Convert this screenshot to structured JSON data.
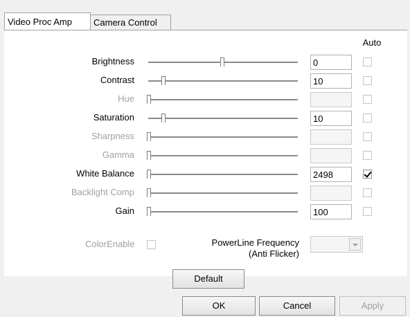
{
  "tabs": [
    {
      "label": "Video Proc Amp",
      "active": true
    },
    {
      "label": "Camera Control",
      "active": false
    }
  ],
  "auto_header": "Auto",
  "controls": [
    {
      "label": "Brightness",
      "value": "0",
      "slider_fraction": 0.5,
      "enabled": true,
      "auto": false,
      "auto_enabled": false
    },
    {
      "label": "Contrast",
      "value": "10",
      "slider_fraction": 0.1,
      "enabled": true,
      "auto": false,
      "auto_enabled": false
    },
    {
      "label": "Hue",
      "value": "",
      "slider_fraction": 0.0,
      "enabled": false,
      "auto": false,
      "auto_enabled": false
    },
    {
      "label": "Saturation",
      "value": "10",
      "slider_fraction": 0.1,
      "enabled": true,
      "auto": false,
      "auto_enabled": false
    },
    {
      "label": "Sharpness",
      "value": "",
      "slider_fraction": 0.0,
      "enabled": false,
      "auto": false,
      "auto_enabled": false
    },
    {
      "label": "Gamma",
      "value": "",
      "slider_fraction": 0.0,
      "enabled": false,
      "auto": false,
      "auto_enabled": false
    },
    {
      "label": "White Balance",
      "value": "2498",
      "slider_fraction": 0.0,
      "enabled": true,
      "auto": true,
      "auto_enabled": true
    },
    {
      "label": "Backlight Comp",
      "value": "",
      "slider_fraction": 0.0,
      "enabled": false,
      "auto": false,
      "auto_enabled": false
    },
    {
      "label": "Gain",
      "value": "100",
      "slider_fraction": 0.0,
      "enabled": true,
      "auto": false,
      "auto_enabled": false
    }
  ],
  "color_enable": {
    "label": "ColorEnable",
    "checked": false,
    "enabled": false
  },
  "powerline": {
    "label_line1": "PowerLine Frequency",
    "label_line2": "(Anti Flicker)",
    "selected": ""
  },
  "buttons": {
    "default": "Default",
    "ok": "OK",
    "cancel": "Cancel",
    "apply": "Apply"
  }
}
